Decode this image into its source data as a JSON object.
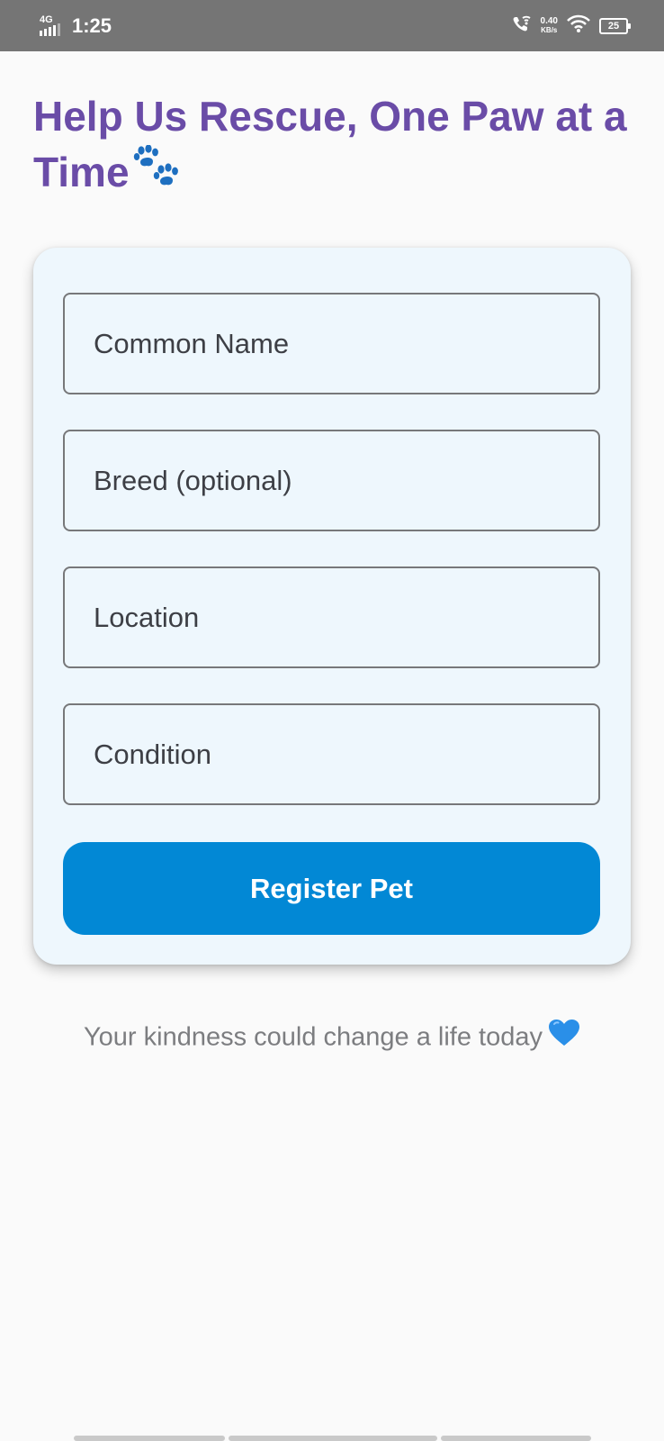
{
  "status_bar": {
    "network": "4G",
    "time": "1:25",
    "speed_value": "0.40",
    "speed_unit": "KB/s",
    "battery": "25",
    "icons": [
      "signal-icon",
      "wifi-calling-icon",
      "wifi-icon",
      "battery-icon"
    ]
  },
  "header": {
    "title": "Help Us Rescue, One Paw at a Time",
    "title_icon": "paw-prints-icon",
    "title_color": "#6a4ca7"
  },
  "form": {
    "fields": [
      {
        "placeholder": "Common Name",
        "value": ""
      },
      {
        "placeholder": "Breed (optional)",
        "value": ""
      },
      {
        "placeholder": "Location",
        "value": ""
      },
      {
        "placeholder": "Condition",
        "value": ""
      }
    ],
    "submit_label": "Register Pet",
    "submit_color": "#0288d5",
    "card_background": "#eef7fd"
  },
  "footer": {
    "message": "Your kindness could change a life today",
    "message_icon": "blue-heart-icon"
  }
}
